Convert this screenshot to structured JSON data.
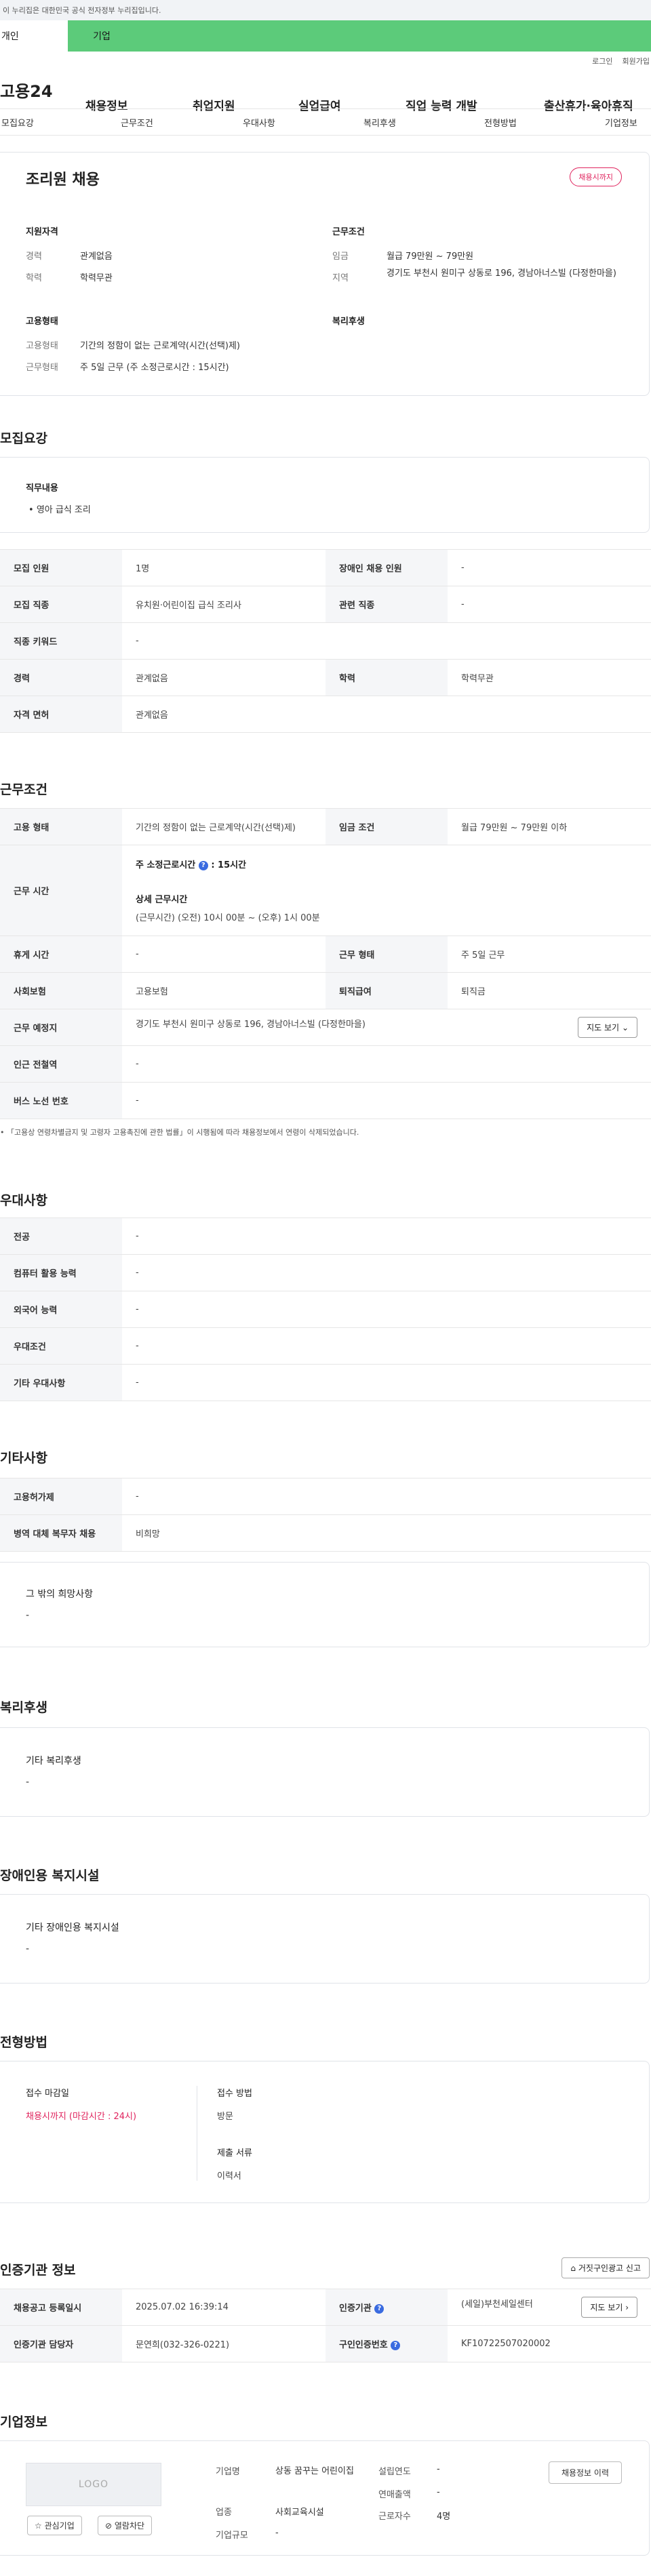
{
  "gov_notice": "이 누리집은 대한민국 공식 전자정부 누리집입니다.",
  "usertype_tabs": [
    "개인",
    "기업"
  ],
  "util_links": [
    "로그인",
    "회원가입"
  ],
  "gnb": {
    "logo": "고용24",
    "menus": [
      "채용정보",
      "취업지원",
      "실업급여",
      "직업 능력 개발",
      "출산휴가·육아휴직"
    ]
  },
  "subnav": [
    "모집요강",
    "근무조건",
    "우대사항",
    "복리후생",
    "전형방법",
    "기업정보"
  ],
  "summary": {
    "title": "조리원 채용",
    "status_badge": "채용시까지",
    "qualification": {
      "title": "지원자격",
      "rows": [
        [
          "경력",
          "관계없음"
        ],
        [
          "학력",
          "학력무관"
        ]
      ]
    },
    "conditions": {
      "title": "근무조건",
      "rows": [
        [
          "임금",
          "월급 79만원 ~ 79만원"
        ],
        [
          "지역",
          "경기도 부천시 원미구 상동로 196, 경남아너스빌 (다정한마을)"
        ]
      ]
    },
    "employment": {
      "title": "고용형태",
      "rows": [
        [
          "고용형태",
          "기간의 정함이 없는 근로계약(시간(선택)제)"
        ],
        [
          "근무형태",
          "주 5일 근무 (주 소정근로시간 : 15시간)"
        ]
      ]
    },
    "welfare_title": "복리후생"
  },
  "recruit": {
    "section_title": "모집요강",
    "duty_title": "직무내용",
    "duty_item": "영아 급식 조리",
    "table": {
      "r1": [
        "모집 인원",
        "1명",
        "장애인 채용 인원",
        "-"
      ],
      "r2": [
        "모집 직종",
        "유치원·어린이집 급식 조리사",
        "관련 직종",
        "-"
      ],
      "r3": [
        "직종 키워드",
        "-"
      ],
      "r4": [
        "경력",
        "관계없음",
        "학력",
        "학력무관"
      ],
      "r5": [
        "자격 면허",
        "관계없음"
      ]
    }
  },
  "work": {
    "section_title": "근무조건",
    "r1": [
      "고용 형태",
      "기간의 정함이 없는 근로계약(시간(선택)제)",
      "임금 조건",
      "월급 79만원 ~ 79만원 이하"
    ],
    "hours_label": "근무 시간",
    "hours_weekly": "주 소정근로시간",
    "hours_weekly_value": ": 15시간",
    "hours_detail_label": "상세 근무시간",
    "hours_detail_value": "(근무시간) (오전) 10시 00분 ~ (오후) 1시 00분",
    "r3": [
      "휴게 시간",
      "-",
      "근무 형태",
      "주 5일 근무"
    ],
    "r4": [
      "사회보험",
      "고용보험",
      "퇴직급여",
      "퇴직금"
    ],
    "r5": [
      "근무 예정지",
      "경기도 부천시 원미구 상동로 196, 경남아너스빌 (다정한마을)"
    ],
    "map_button": "지도 보기",
    "r6": [
      "인근 전철역",
      "-"
    ],
    "r7": [
      "버스 노선 번호",
      "-"
    ],
    "footnote": "「고용상 연령차별금지 및 고령자 고용촉진에 관한 법률」이 시행됨에 따라 채용정보에서 연령이 삭제되었습니다."
  },
  "preference": {
    "section_title": "우대사항",
    "rows": [
      [
        "전공",
        "-"
      ],
      [
        "컴퓨터 활용 능력",
        "-"
      ],
      [
        "외국어 능력",
        "-"
      ],
      [
        "우대조건",
        "-"
      ],
      [
        "기타 우대사항",
        "-"
      ]
    ]
  },
  "other": {
    "section_title": "기타사항",
    "rows": [
      [
        "고용허가제",
        "-"
      ],
      [
        "병역 대체 복무자 채용",
        "비희망"
      ]
    ],
    "box_title": "그 밖의 희망사항",
    "box_value": "-"
  },
  "welfare": {
    "section_title": "복리후생",
    "box_title": "기타 복리후생",
    "box_value": "-"
  },
  "disability": {
    "section_title": "장애인용 복지시설",
    "box_title": "기타 장애인용 복지시설",
    "box_value": "-"
  },
  "selection": {
    "section_title": "전형방법",
    "deadline_label": "접수 마감일",
    "deadline_value": "채용시까지 (마감시간 : 24시)",
    "method_label": "접수 방법",
    "method_value": "방문",
    "docs_label": "제출 서류",
    "docs_value": "이력서"
  },
  "agency": {
    "section_title": "인증기관 정보",
    "report_button": "거짓구인광고 신고",
    "r1": [
      "채용공고 등록일시",
      "2025.07.02 16:39:14",
      "인증기관",
      "(세일)부천세일센터"
    ],
    "map_button": "지도 보기",
    "r2": [
      "인증기관 담당자",
      "문연희(032-326-0221)",
      "구인인증번호",
      "KF10722507020002"
    ]
  },
  "company": {
    "section_title": "기업정보",
    "logo_text": "LOGO",
    "interest_button": "관심기업",
    "block_button": "열람차단",
    "history_button": "채용정보 이력",
    "name_label": "기업명",
    "name_value": "상동 꿈꾸는 어린이집",
    "industry_label": "업종",
    "industry_value": "사회교육시설",
    "size_label": "기업규모",
    "size_value": "-",
    "founded_label": "설립연도",
    "founded_value": "-",
    "revenue_label": "연매출액",
    "revenue_value": "-",
    "employees_label": "근로자수",
    "employees_value": "4명"
  }
}
